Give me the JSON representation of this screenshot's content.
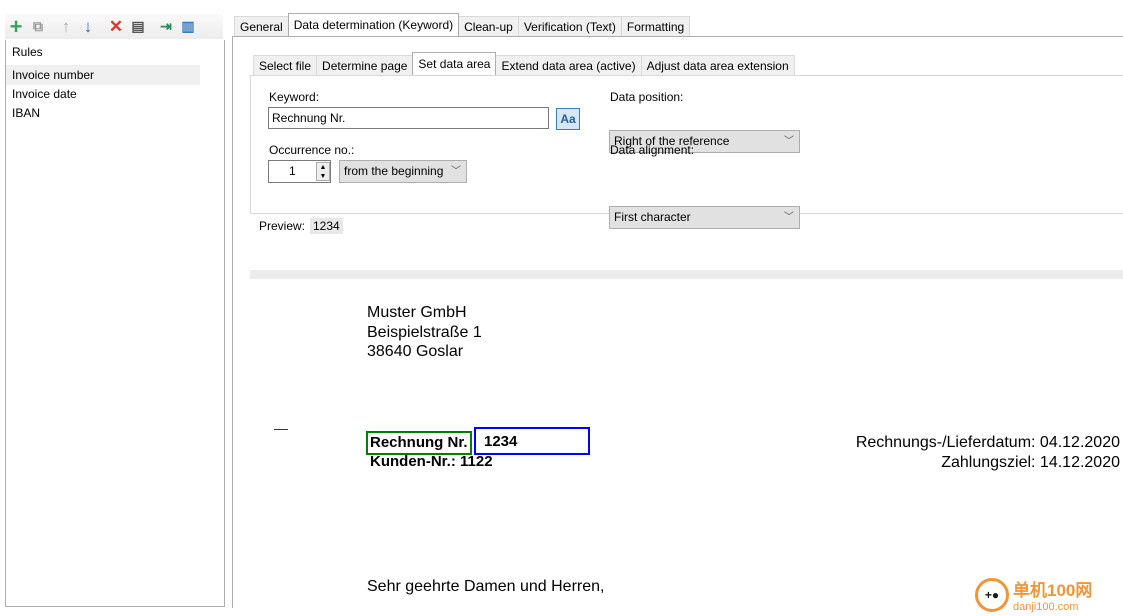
{
  "toolbar": {
    "icons": [
      "add-icon",
      "copy-icon",
      "move-up-icon",
      "move-down-icon",
      "delete-icon",
      "delete-all-icon",
      "import-icon",
      "columns-icon"
    ]
  },
  "rules": {
    "header": "Rules",
    "items": [
      "Invoice number",
      "Invoice date",
      "IBAN"
    ],
    "selected": 0
  },
  "main_tabs": [
    "General",
    "Data determination (Keyword)",
    "Clean-up",
    "Verification (Text)",
    "Formatting"
  ],
  "main_active": 1,
  "sub_tabs": [
    "Select file",
    "Determine page",
    "Set data area",
    "Extend data area (active)",
    "Adjust data area extension"
  ],
  "sub_active": 2,
  "form": {
    "keyword_label": "Keyword:",
    "keyword_value": "Rechnung Nr.",
    "case_button": "Aa",
    "occurrence_label": "Occurrence no.:",
    "occurrence_value": "1",
    "occurrence_from": "from the beginning",
    "position_label": "Data position:",
    "position_value": "Right of the reference",
    "alignment_label": "Data alignment:",
    "alignment_value": "First character"
  },
  "preview": {
    "label": "Preview:",
    "value": "1234"
  },
  "document": {
    "address": [
      "Muster GmbH",
      "Beispielstraße 1",
      "38640 Goslar"
    ],
    "keyword": "Rechnung Nr.",
    "value": "1234",
    "customer": "Kunden-Nr.: 1122",
    "date_line": "Rechnungs-/Lieferdatum: 04.12.2020",
    "due_line": "Zahlungsziel: 14.12.2020",
    "greeting": "Sehr geehrte Damen und Herren,",
    "keyword_box_color": "#008000",
    "value_box_color": "#0000ff"
  },
  "watermark": {
    "text": "单机100网",
    "url_text": "danji100.com"
  }
}
